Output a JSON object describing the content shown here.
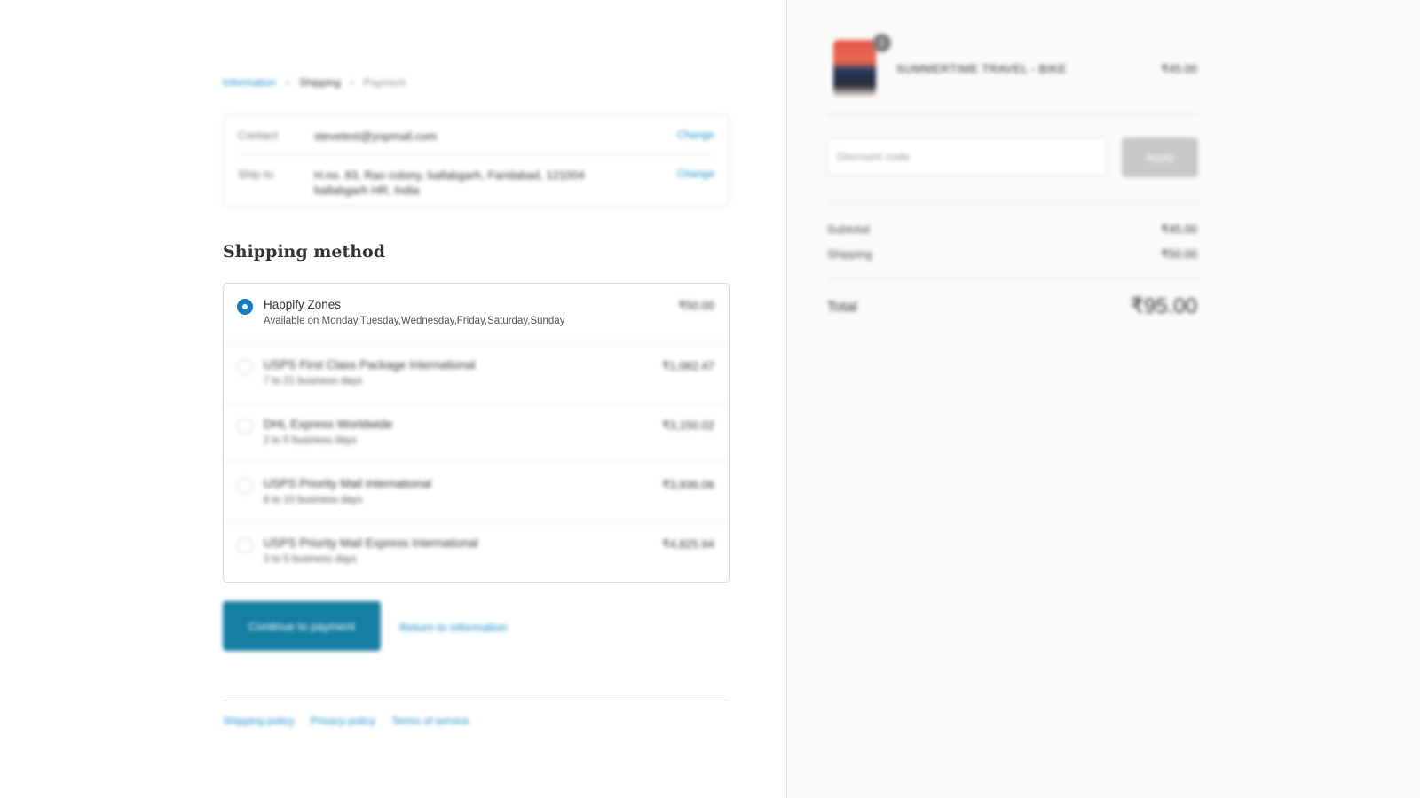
{
  "breadcrumb": {
    "information": "Information",
    "shipping": "Shipping",
    "payment": "Payment"
  },
  "review": {
    "contact_label": "Contact",
    "contact_value": "stevetest@yopmail.com",
    "ship_to_label": "Ship to",
    "ship_to_value_line1": "H.no. 83, Rao colony, ballabgarh, Faridabad, 121004",
    "ship_to_value_line2": "ballabgarh HR, India",
    "change_label": "Change"
  },
  "shipping_method": {
    "title": "Shipping method",
    "options": [
      {
        "name": "Happify Zones",
        "sub": "Available on Monday,Tuesday,Wednesday,Friday,Saturday,Sunday",
        "price": "₹50.00",
        "selected": true
      },
      {
        "name": "USPS First Class Package International",
        "sub": "7 to 21 business days",
        "price": "₹1,082.47",
        "selected": false
      },
      {
        "name": "DHL Express Worldwide",
        "sub": "2 to 5 business days",
        "price": "₹3,150.02",
        "selected": false
      },
      {
        "name": "USPS Priority Mail International",
        "sub": "6 to 10 business days",
        "price": "₹3,936.06",
        "selected": false
      },
      {
        "name": "USPS Priority Mail Express International",
        "sub": "3 to 5 business days",
        "price": "₹4,825.94",
        "selected": false
      }
    ]
  },
  "actions": {
    "continue_label": "Continue to payment",
    "return_label": "Return to information"
  },
  "footer": {
    "links": [
      "Shipping policy",
      "Privacy policy",
      "Terms of service"
    ]
  },
  "summary": {
    "product": {
      "name": "SUMMERTIME TRAVEL - BIKE",
      "price": "₹45.00",
      "quantity": "1"
    },
    "discount_placeholder": "Discount code",
    "apply_label": "Apply",
    "subtotal_label": "Subtotal",
    "subtotal_value": "₹45.00",
    "shipping_label": "Shipping",
    "shipping_value": "₹50.00",
    "total_label": "Total",
    "total_value": "₹95.00"
  },
  "colors": {
    "accent": "#157ea3",
    "link": "#1990c6",
    "radio_selected": "#197bbd"
  }
}
